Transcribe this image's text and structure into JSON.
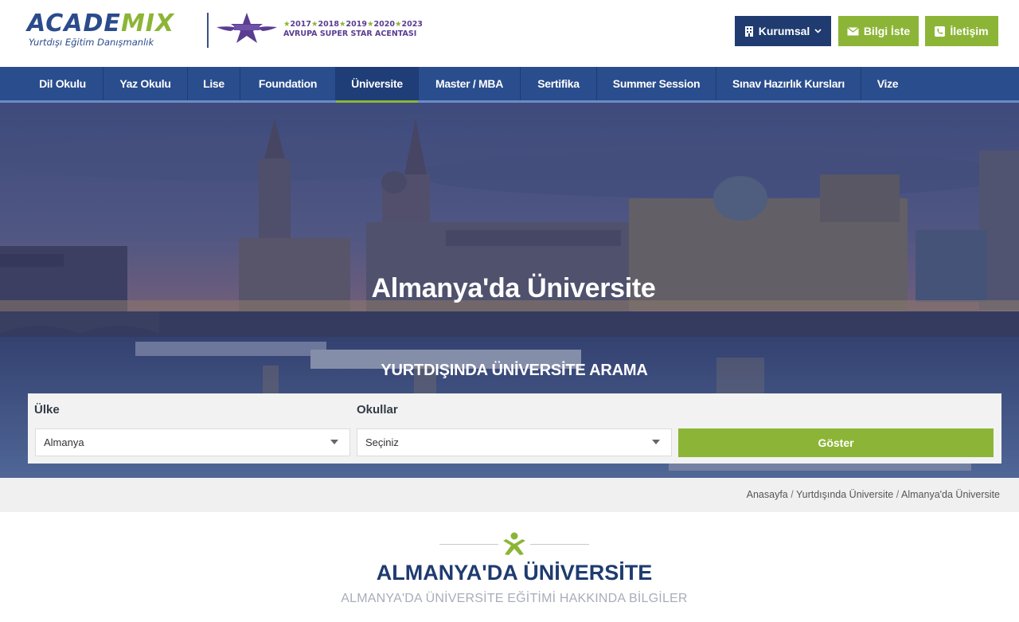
{
  "brand": {
    "logo_part1": "ACADE",
    "logo_part2": "MIX",
    "logo_tagline": "Yurtdışı Eğitim Danışmanlık",
    "award_years": [
      "2017",
      "2018",
      "2019",
      "2020",
      "2023"
    ],
    "award_title": "AVRUPA SUPER STAR ACENTASI"
  },
  "header_buttons": {
    "kurumsal": "Kurumsal",
    "bilgi_iste": "Bilgi İste",
    "iletisim": "İletişim"
  },
  "nav": {
    "items": [
      {
        "label": "Dil Okulu"
      },
      {
        "label": "Yaz Okulu"
      },
      {
        "label": "Lise"
      },
      {
        "label": "Foundation"
      },
      {
        "label": "Üniversite",
        "active": true
      },
      {
        "label": "Master / MBA"
      },
      {
        "label": "Sertifika"
      },
      {
        "label": "Summer Session"
      },
      {
        "label": "Sınav Hazırlık Kursları"
      },
      {
        "label": "Vize"
      }
    ]
  },
  "hero": {
    "title": "Almanya'da Üniversite",
    "search_heading": "YURTDIŞINDA ÜNİVERSİTE ARAMA"
  },
  "search": {
    "country_label": "Ülke",
    "country_value": "Almanya",
    "schools_label": "Okullar",
    "schools_value": "Seçiniz",
    "submit_label": "Göster"
  },
  "breadcrumb": {
    "items": [
      "Anasayfa",
      "Yurtdışında Üniversite",
      "Almanya'da Üniversite"
    ],
    "separator": "/"
  },
  "section": {
    "title": "ALMANYA'DA ÜNİVERSİTE",
    "subtitle": "ALMANYA'DA ÜNİVERSİTE EĞİTİMİ HAKKINDA BİLGİLER"
  },
  "colors": {
    "primary_navy": "#1f3b70",
    "nav_blue": "#2a4d8d",
    "accent_green": "#8cb537",
    "award_purple": "#5a3d91"
  },
  "icons": {
    "kurumsal": "building-icon",
    "bilgi_iste": "envelope-icon",
    "iletisim": "phone-icon",
    "dropdown": "chevron-down-icon",
    "section": "academix-person-icon"
  }
}
